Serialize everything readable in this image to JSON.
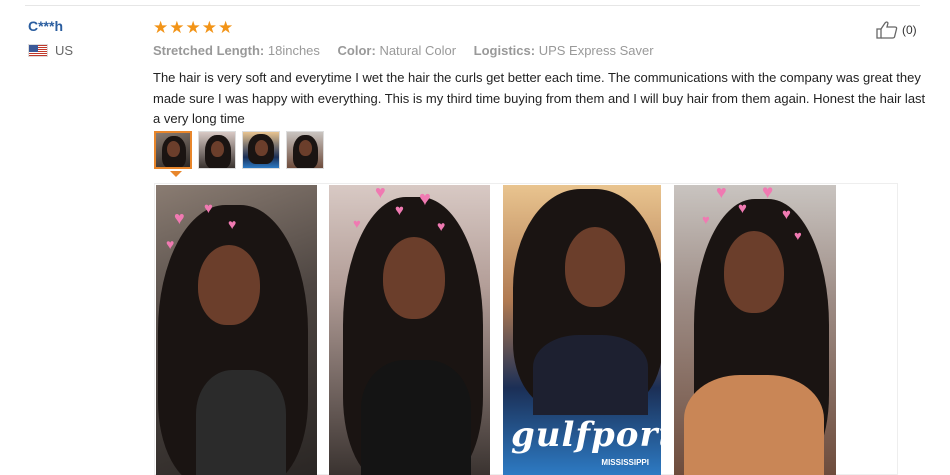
{
  "reviewer": {
    "name": "C***h",
    "country": "US",
    "flag_icon": "us-flag-icon"
  },
  "rating": {
    "stars": 5,
    "max": 5,
    "color": "#f29418"
  },
  "helpful": {
    "icon": "thumbs-up-icon",
    "count_label": "(0)"
  },
  "specs": [
    {
      "label": "Stretched Length:",
      "value": "18inches"
    },
    {
      "label": "Color:",
      "value": "Natural Color"
    },
    {
      "label": "Logistics:",
      "value": "UPS Express Saver"
    }
  ],
  "review_text": "The hair is very soft and everytime I wet the hair the curls get better each time. The communications with the company was great they made sure I was happy with everything. This is my third time buying from them and I will buy hair from them again. Honest the hair last a very long time",
  "thumbnails": {
    "count": 4,
    "selected_index": 0
  },
  "photos": {
    "count": 4,
    "photo3_caption": "gulfport",
    "photo3_subcaption": "MISSISSIPPI"
  },
  "colors": {
    "username": "#2a5d9f",
    "accent": "#e8862b"
  }
}
